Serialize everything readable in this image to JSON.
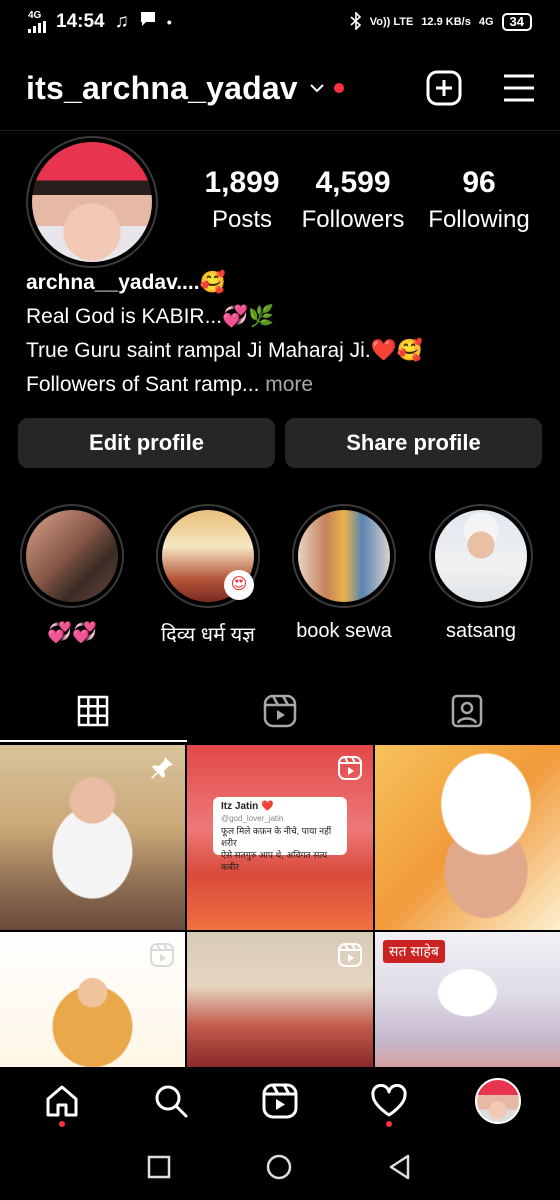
{
  "status_bar": {
    "network": "4G",
    "time": "14:54",
    "volte": "Vo)) LTE",
    "speed": "12.9 KB/s",
    "network_right": "4G",
    "battery": "34"
  },
  "header": {
    "username": "its_archna_yadav"
  },
  "profile": {
    "stats": [
      {
        "value": "1,899",
        "label": "Posts"
      },
      {
        "value": "4,599",
        "label": "Followers"
      },
      {
        "value": "96",
        "label": "Following"
      }
    ],
    "bio": {
      "name": "archna__yadav....🥰",
      "line1": "Real God is KABIR...💞🌿",
      "line2": "True Guru saint rampal Ji Maharaj Ji.❤️🥰",
      "line3": "Followers of Sant ramp...",
      "more": " more"
    }
  },
  "buttons": {
    "edit": "Edit profile",
    "share": "Share profile"
  },
  "highlights": [
    {
      "label": "💞💞"
    },
    {
      "label": "दिव्य धर्म यज्ञ"
    },
    {
      "label": "book sewa"
    },
    {
      "label": "satsang"
    }
  ],
  "highlight_badge": "😍",
  "post_card": {
    "name": "Itz Jatin ❤️",
    "handle": "@god_lover_jatin",
    "text1": "फूल मिले कफ़न के नीचे, पाया नहीं शरीर",
    "text2": "ऐसे सतगुरु आप थे, अविगत सत्य कबीर"
  },
  "sign_text": "सत साहेब",
  "colors": {
    "background": "#000000",
    "button_bg": "#262626",
    "notification_dot": "#ff3040",
    "muted_text": "#a8a8a8"
  }
}
